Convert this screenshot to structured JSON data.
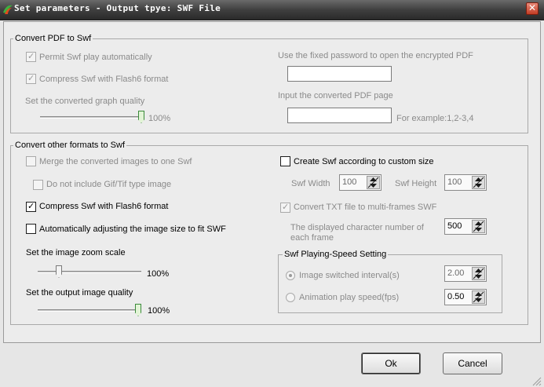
{
  "window": {
    "title": "Set parameters - Output tpye: SWF File",
    "close_glyph": "✕"
  },
  "pdf_group": {
    "legend": "Convert PDF to Swf",
    "permit_play": {
      "label": "Permit Swf play automatically",
      "checked": true,
      "enabled": false
    },
    "compress_flash6": {
      "label": "Compress Swf with Flash6 format",
      "checked": true,
      "enabled": false
    },
    "quality_label": "Set the converted graph quality",
    "quality_value": "100%",
    "quality_level": 1.0,
    "password_label": "Use the fixed password to open the encrypted PDF",
    "password_value": "",
    "page_label": "Input the converted PDF page",
    "page_value": "",
    "page_example": "For example:1,2-3,4"
  },
  "other_group": {
    "legend": "Convert other formats to Swf",
    "merge_images": {
      "label": "Merge the converted images to one Swf",
      "checked": false,
      "enabled": false
    },
    "no_gif_tif": {
      "label": "Do not include Gif/Tif type image",
      "checked": false,
      "enabled": false
    },
    "compress_flash6": {
      "label": "Compress Swf with Flash6 format",
      "checked": true,
      "enabled": true
    },
    "auto_adjust": {
      "label": "Automatically adjusting the image size to fit SWF",
      "checked": false,
      "enabled": true
    },
    "zoom_label": "Set the image zoom scale",
    "zoom_value": "100%",
    "zoom_level": 0.25,
    "output_quality_label": "Set the output image quality",
    "output_quality_value": "100%",
    "output_quality_level": 1.0,
    "custom_size": {
      "label": "Create Swf according to custom size",
      "checked": false,
      "enabled": true
    },
    "swf_width_label": "Swf Width",
    "swf_width_value": "100",
    "swf_height_label": "Swf Height",
    "swf_height_value": "100",
    "txt_multiframe": {
      "label": "Convert TXT file to multi-frames SWF",
      "checked": true,
      "enabled": false
    },
    "char_number_label": "The displayed character number of each frame",
    "char_number_value": "500",
    "speed_group": {
      "legend": "Swf Playing-Speed Setting",
      "interval": {
        "label": "Image switched interval(s)",
        "selected": true,
        "value": "2.00"
      },
      "fps": {
        "label": "Animation play speed(fps)",
        "selected": false,
        "value": "0.50"
      }
    }
  },
  "buttons": {
    "ok": "Ok",
    "cancel": "Cancel"
  }
}
